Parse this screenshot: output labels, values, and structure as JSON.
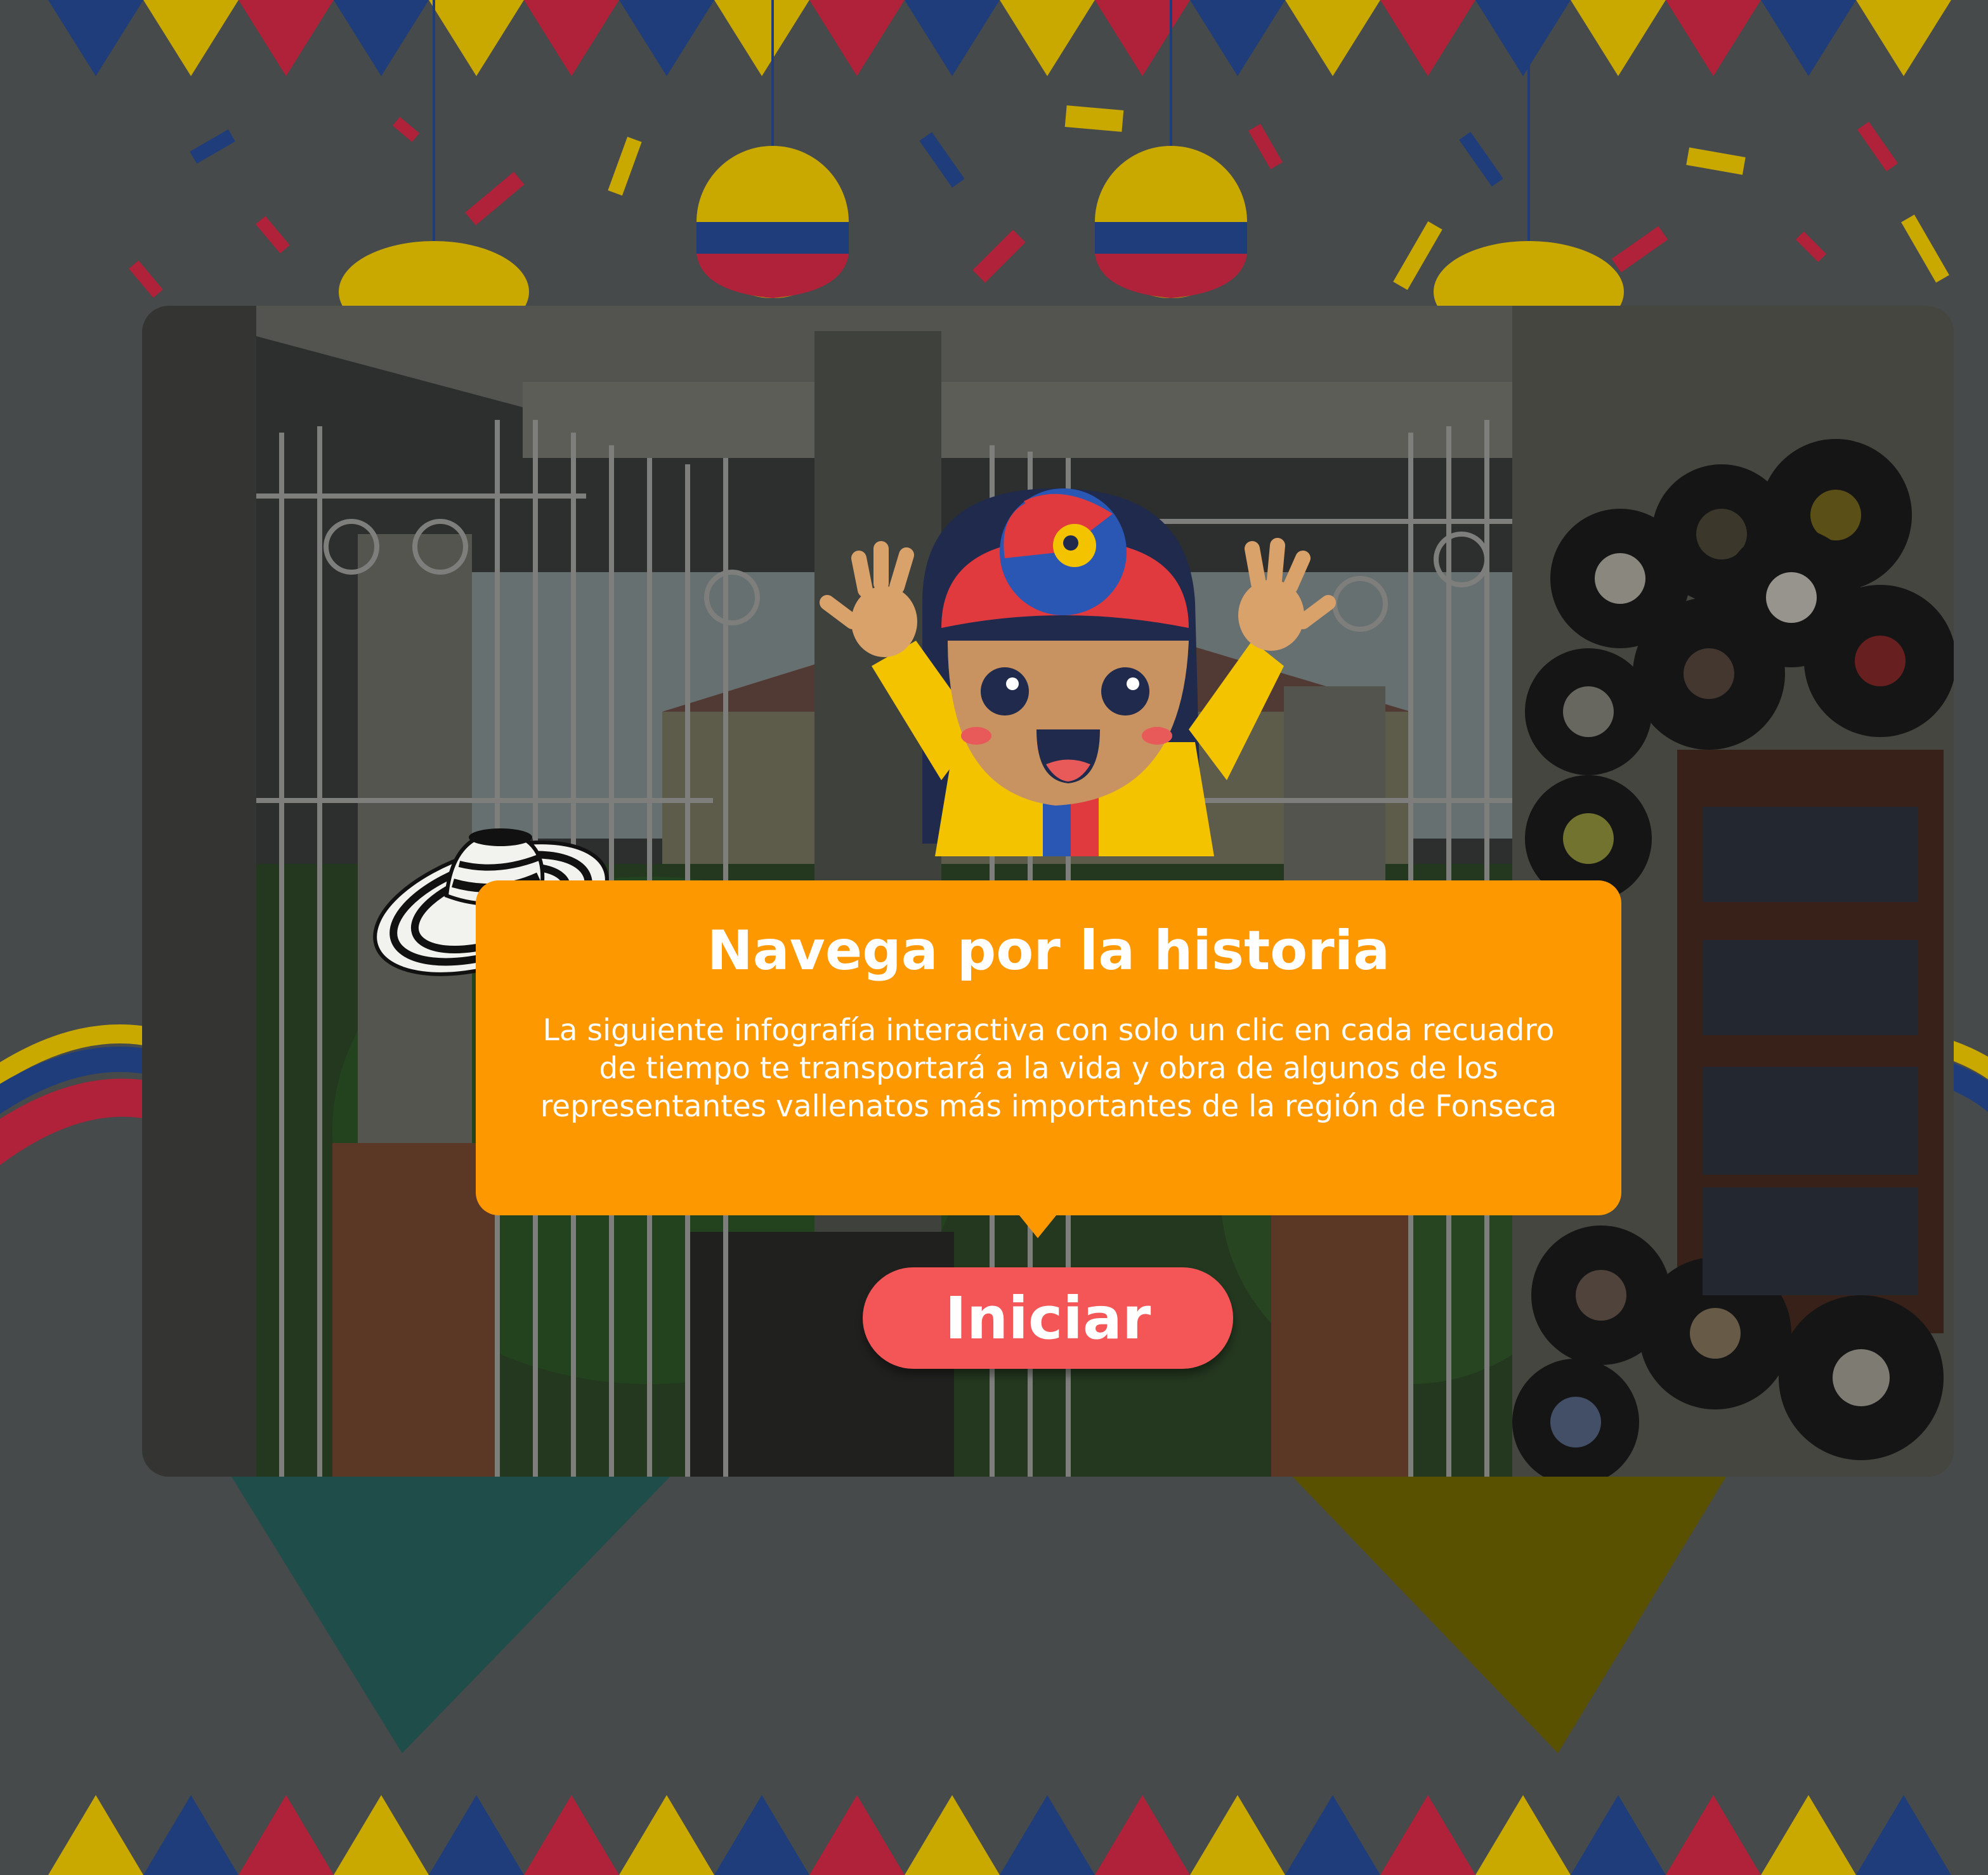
{
  "intro": {
    "title": "Navega por la historia",
    "description": "La siguiente infografía interactiva con solo un clic en cada recuadro de tiempo te transportará a la vida y obra de algunos de los representantes vallenatos más importantes de la región de Fonseca",
    "start_label": "Iniciar"
  },
  "icons": {
    "character": "mascot-character-icon",
    "hat": "sombrero-vueltiao-icon",
    "lanterns": "festive-lantern-icon",
    "flags": "bunting-flags-icon"
  },
  "colors": {
    "overlay": "#464a4b",
    "bubble": "#fe9800",
    "button": "#f45657",
    "text": "#ffffff",
    "flag_yellow": "#c9a800",
    "flag_blue": "#1f3d7a",
    "flag_red": "#b0213a"
  }
}
